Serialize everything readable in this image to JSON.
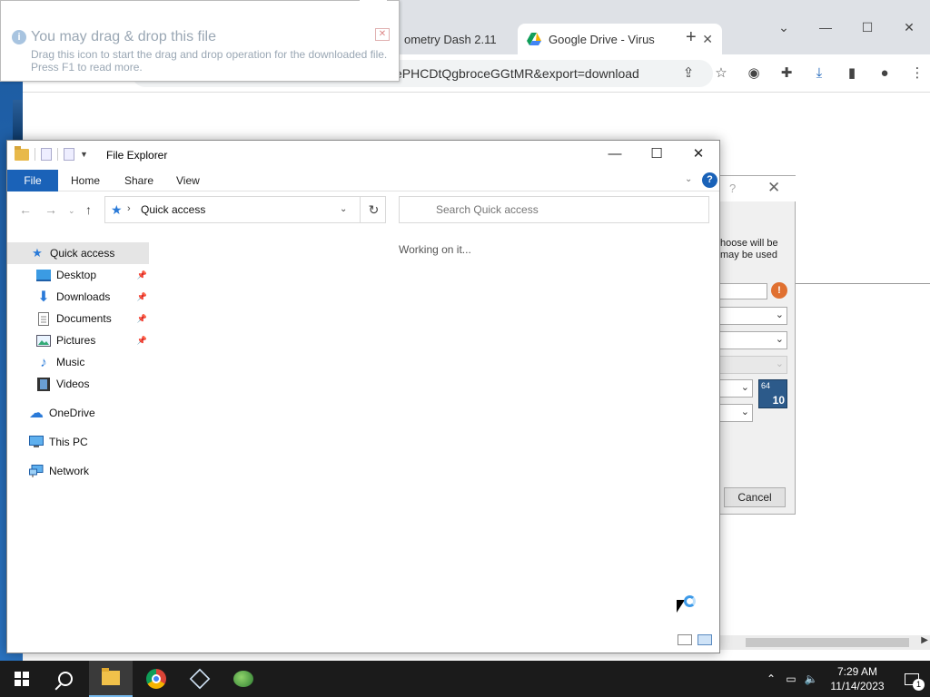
{
  "tooltip": {
    "title": "You may drag & drop this file",
    "body": "Drag this icon to start the drag and drop operation for the downloaded file. Press F1 to read more."
  },
  "chrome": {
    "tabs": [
      {
        "label": "ometry Dash 2.11",
        "active": false
      },
      {
        "label": "Google Drive - Virus",
        "active": true
      }
    ],
    "address": "ePHCDtQgbroceGGtMR&export=download"
  },
  "dialog": {
    "text_line1": "hoose will be",
    "text_line2": "may be used",
    "badge_top": "64",
    "badge_bottom": "10",
    "cancel_label": "Cancel"
  },
  "explorer": {
    "title": "File Explorer",
    "ribbon": {
      "file": "File",
      "home": "Home",
      "share": "Share",
      "view": "View"
    },
    "address": {
      "path": "Quick access"
    },
    "search_placeholder": "Search Quick access",
    "status": "Working on it...",
    "nav": [
      {
        "label": "Quick access",
        "icon": "star-icon",
        "selected": true
      },
      {
        "label": "Desktop",
        "icon": "desktop-icon",
        "pinned": true
      },
      {
        "label": "Downloads",
        "icon": "download-icon",
        "pinned": true
      },
      {
        "label": "Documents",
        "icon": "document-icon",
        "pinned": true
      },
      {
        "label": "Pictures",
        "icon": "picture-icon",
        "pinned": true
      },
      {
        "label": "Music",
        "icon": "music-icon"
      },
      {
        "label": "Videos",
        "icon": "video-icon"
      },
      {
        "label": "OneDrive",
        "icon": "cloud-icon"
      },
      {
        "label": "This PC",
        "icon": "computer-icon"
      },
      {
        "label": "Network",
        "icon": "network-icon"
      }
    ]
  },
  "taskbar": {
    "time": "7:29 AM",
    "date": "11/14/2023",
    "notification_count": "1"
  },
  "colors": {
    "accent": "#1a62b8",
    "taskbar": "#1b1b1b",
    "selection": "#e5e5e5"
  }
}
